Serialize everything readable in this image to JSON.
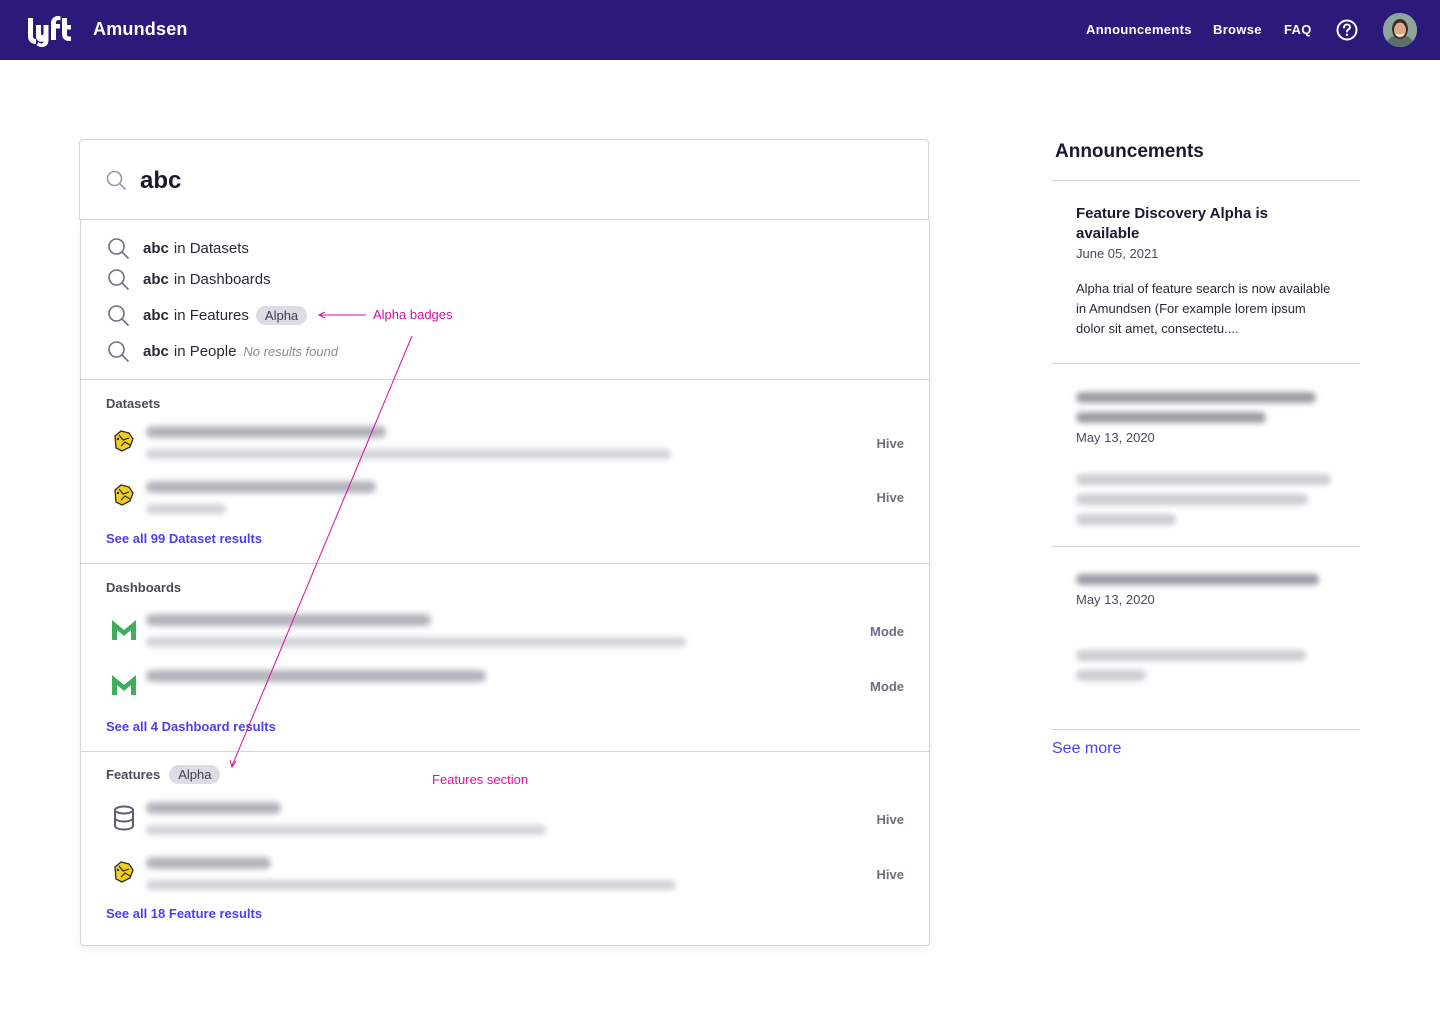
{
  "nav": {
    "brand": "Amundsen",
    "links": [
      "Announcements",
      "Browse",
      "FAQ"
    ],
    "help_icon": "help-circle-icon",
    "avatar_icon": "user-avatar"
  },
  "search": {
    "query": "abc",
    "suggestions": [
      {
        "query": "abc",
        "scope": "in Datasets"
      },
      {
        "query": "abc",
        "scope": "in Dashboards"
      },
      {
        "query": "abc",
        "scope": "in Features",
        "badge": "Alpha"
      },
      {
        "query": "abc",
        "scope": "in People",
        "note": "No results found"
      }
    ]
  },
  "sections": {
    "datasets": {
      "title": "Datasets",
      "results": [
        {
          "source": "Hive",
          "icon": "hive-icon"
        },
        {
          "source": "Hive",
          "icon": "hive-icon"
        }
      ],
      "see_all": "See all 99 Dataset results"
    },
    "dashboards": {
      "title": "Dashboards",
      "results": [
        {
          "source": "Mode",
          "icon": "mode-icon"
        },
        {
          "source": "Mode",
          "icon": "mode-icon"
        }
      ],
      "see_all": "See all 4 Dashboard results"
    },
    "features": {
      "title": "Features",
      "badge": "Alpha",
      "results": [
        {
          "source": "Hive",
          "icon": "database-icon"
        },
        {
          "source": "Hive",
          "icon": "hive-icon"
        }
      ],
      "see_all": "See all 18 Feature results"
    }
  },
  "annotations": {
    "alpha_badges": "Alpha badges",
    "features_section": "Features section"
  },
  "announcements": {
    "title": "Announcements",
    "items": [
      {
        "title": "Feature Discovery Alpha is available",
        "date": "June 05, 2021",
        "body": "Alpha trial of feature search is now available in Amundsen (For example lorem ipsum dolor sit amet, consectetu...."
      },
      {
        "date": "May 13, 2020"
      },
      {
        "date": "May 13, 2020"
      }
    ],
    "see_more": "See more"
  },
  "colors": {
    "nav_bg": "#2b1a7a",
    "link": "#4f3df0",
    "annotation": "#d60fa4",
    "badge_bg": "#dcdbe6"
  }
}
